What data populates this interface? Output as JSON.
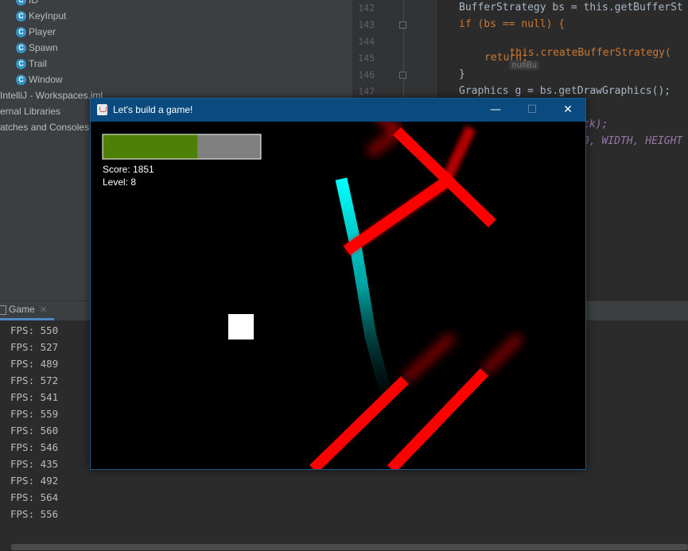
{
  "project_tree": {
    "items": [
      {
        "label": "ID",
        "icon": "class-icon"
      },
      {
        "label": "KeyInput",
        "icon": "class-icon"
      },
      {
        "label": "Player",
        "icon": "class-icon"
      },
      {
        "label": "Spawn",
        "icon": "class-icon"
      },
      {
        "label": "Trail",
        "icon": "class-icon"
      },
      {
        "label": "Window",
        "icon": "class-icon"
      }
    ],
    "iml_file": "IntelliJ - Workspaces.iml",
    "external_libraries": "ernal Libraries",
    "scratches": "atches and Consoles"
  },
  "editor": {
    "line_numbers": [
      "142",
      "143",
      "144",
      "145",
      "146",
      "147"
    ],
    "lines": {
      "l142": "BufferStrategy bs = this.getBufferSt",
      "l143": "if (bs == null) {",
      "l144": "this.createBufferStrategy(",
      "l144_hint": "numBu",
      "l145": "return;",
      "l146": "}",
      "l147": "Graphics g = bs.getDrawGraphics();",
      "l148_tail": "ck);",
      "l149_tail": "0, WIDTH, HEIGHT"
    }
  },
  "run_panel": {
    "tab_label": "Game",
    "fps_lines": [
      "FPS: 550",
      "FPS: 527",
      "FPS: 489",
      "FPS: 572",
      "FPS: 541",
      "FPS: 559",
      "FPS: 560",
      "FPS: 546",
      "FPS: 435",
      "FPS: 492",
      "FPS: 564",
      "FPS: 556"
    ]
  },
  "game_window": {
    "title": "Let's build a game!",
    "minimize_glyph": "—",
    "maximize_glyph": "☐",
    "close_glyph": "✕",
    "health": 0.6,
    "score_text": "Score: 1851",
    "level_text": "Level: 8",
    "colors": {
      "health_fill": "#4e8005",
      "health_empty": "#808080",
      "enemy": "#ff0000",
      "trail": "#00ffff",
      "player": "#ffffff",
      "titlebar": "#0a4a7e"
    }
  }
}
